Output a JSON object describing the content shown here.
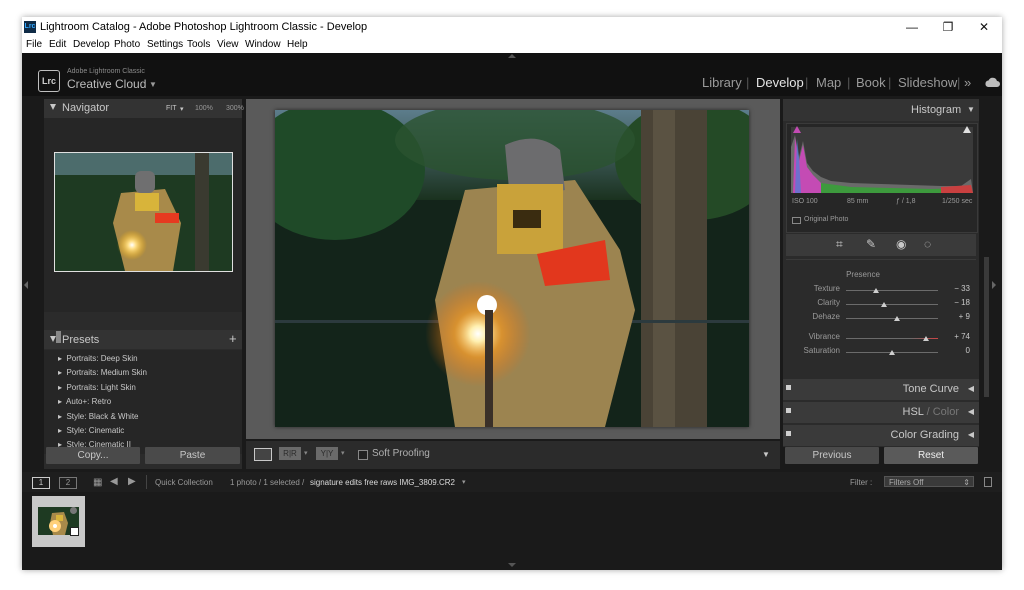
{
  "titlebar": {
    "title": "Lightroom Catalog - Adobe Photoshop Lightroom Classic - Develop",
    "app_icon": "Lrc"
  },
  "menu": [
    "File",
    "Edit",
    "Develop",
    "Photo",
    "Settings",
    "Tools",
    "View",
    "Window",
    "Help"
  ],
  "identity": {
    "logo": "Lrc",
    "sub": "Adobe Lightroom Classic",
    "name": "Creative Cloud"
  },
  "modules": [
    "Library",
    "Develop",
    "Map",
    "Book",
    "Slideshow"
  ],
  "modules_more": "»",
  "active_module": "Develop",
  "navigator": {
    "title": "Navigator",
    "zoom": [
      "FIT",
      "100%",
      "300%"
    ]
  },
  "presets": {
    "title": "Presets",
    "add": "+",
    "items": [
      "Portraits: Deep Skin",
      "Portraits: Medium Skin",
      "Portraits: Light Skin",
      "Auto+: Retro",
      "Style: Black & White",
      "Style: Cinematic",
      "Style: Cinematic II"
    ]
  },
  "left_buttons": {
    "copy": "Copy...",
    "paste": "Paste"
  },
  "toolbar": {
    "soft_proofing": "Soft Proofing"
  },
  "histogram": {
    "title": "Histogram",
    "iso": "ISO 100",
    "focal": "85 mm",
    "aperture": "ƒ / 1,8",
    "shutter": "1/250 sec",
    "original": "Original Photo"
  },
  "presence": {
    "title": "Presence",
    "sliders": [
      {
        "label": "Texture",
        "value": "− 33",
        "pos": 0.33
      },
      {
        "label": "Clarity",
        "value": "− 18",
        "pos": 0.41
      },
      {
        "label": "Dehaze",
        "value": "+ 9",
        "pos": 0.55
      },
      {
        "label": "Vibrance",
        "value": "+ 74",
        "pos": 0.87
      },
      {
        "label": "Saturation",
        "value": "0",
        "pos": 0.5
      }
    ]
  },
  "sections": {
    "tone_curve": "Tone Curve",
    "hsl": "HSL",
    "hsl_sep": " / ",
    "color": "Color",
    "color_grading": "Color Grading"
  },
  "right_buttons": {
    "previous": "Previous",
    "reset": "Reset"
  },
  "filmstrip": {
    "page1": "1",
    "page2": "2",
    "collection": "Quick Collection",
    "count": "1 photo / 1 selected /",
    "filename": "signature edits free raws IMG_3809.CR2",
    "filter_label": "Filter :",
    "filter_value": "Filters Off"
  },
  "colors": {
    "bg": "#1a1a1a",
    "panel": "#2b2b2b",
    "text": "#c8c8c8",
    "active": "#e6e6e6"
  }
}
